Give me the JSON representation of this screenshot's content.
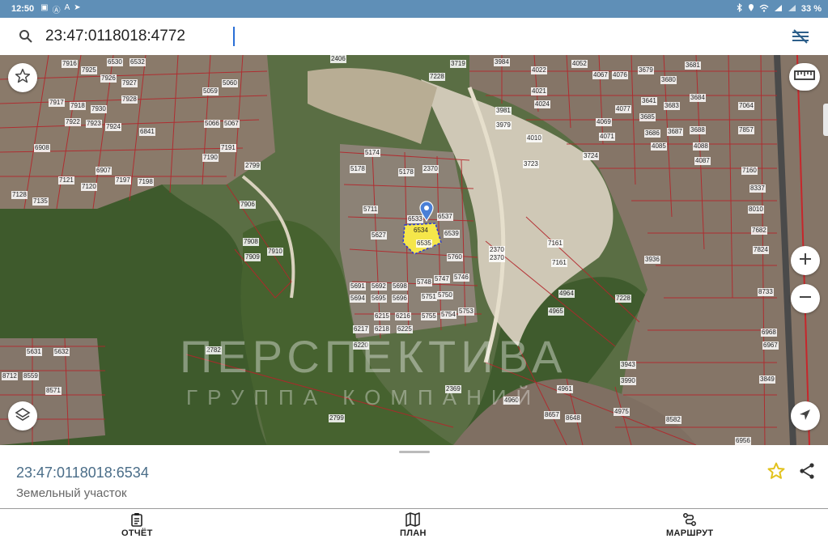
{
  "status_bar": {
    "time": "12:50",
    "left_glyphs": [
      "▣",
      "Ⓐ",
      "A",
      "➤"
    ],
    "battery": "33 %"
  },
  "search": {
    "query": "23:47:0118018:4772",
    "icon": "search-icon",
    "filter_icon": "filter-icon"
  },
  "map": {
    "watermark": "ПЕРСПЕКТИВА",
    "watermark_sub": "ГРУППА КОМПАНИЙ",
    "selected_parcel": "6534",
    "parcels": [
      {
        "id": "7916"
      },
      {
        "id": "7925"
      },
      {
        "id": "7926"
      },
      {
        "id": "7927"
      },
      {
        "id": "7917"
      },
      {
        "id": "7918"
      },
      {
        "id": "7930"
      },
      {
        "id": "7928"
      },
      {
        "id": "7922"
      },
      {
        "id": "7923"
      },
      {
        "id": "7924"
      },
      {
        "id": "6841"
      },
      {
        "id": "6908"
      },
      {
        "id": "6907"
      },
      {
        "id": "7121"
      },
      {
        "id": "7120"
      },
      {
        "id": "7128"
      },
      {
        "id": "7135"
      },
      {
        "id": "7198"
      },
      {
        "id": "7197"
      },
      {
        "id": "6530"
      },
      {
        "id": "6532"
      },
      {
        "id": "5066"
      },
      {
        "id": "5067"
      },
      {
        "id": "5059"
      },
      {
        "id": "5060"
      },
      {
        "id": "7191"
      },
      {
        "id": "7190"
      },
      {
        "id": "2799"
      },
      {
        "id": "7908"
      },
      {
        "id": "7909"
      },
      {
        "id": "7910"
      },
      {
        "id": "7906"
      },
      {
        "id": "2406"
      },
      {
        "id": "5174"
      },
      {
        "id": "5178"
      },
      {
        "id": "5178"
      },
      {
        "id": "2370"
      },
      {
        "id": "6537"
      },
      {
        "id": "6539"
      },
      {
        "id": "6533"
      },
      {
        "id": "6535"
      },
      {
        "id": "5711"
      },
      {
        "id": "5627"
      },
      {
        "id": "5760"
      },
      {
        "id": "5748"
      },
      {
        "id": "5747"
      },
      {
        "id": "5746"
      },
      {
        "id": "5691"
      },
      {
        "id": "5692"
      },
      {
        "id": "5698"
      },
      {
        "id": "5694"
      },
      {
        "id": "5695"
      },
      {
        "id": "5696"
      },
      {
        "id": "5751"
      },
      {
        "id": "5750"
      },
      {
        "id": "6215"
      },
      {
        "id": "6216"
      },
      {
        "id": "5755"
      },
      {
        "id": "5754"
      },
      {
        "id": "5753"
      },
      {
        "id": "6217"
      },
      {
        "id": "6218"
      },
      {
        "id": "6225"
      },
      {
        "id": "6220"
      },
      {
        "id": "2370"
      },
      {
        "id": "2782"
      },
      {
        "id": "5631"
      },
      {
        "id": "5632"
      },
      {
        "id": "8712"
      },
      {
        "id": "8559"
      },
      {
        "id": "8571"
      },
      {
        "id": "2369"
      },
      {
        "id": "2799"
      },
      {
        "id": "7228"
      },
      {
        "id": "3719"
      },
      {
        "id": "3984"
      },
      {
        "id": "4022"
      },
      {
        "id": "4021"
      },
      {
        "id": "3981"
      },
      {
        "id": "3979"
      },
      {
        "id": "4010"
      },
      {
        "id": "4024"
      },
      {
        "id": "4052"
      },
      {
        "id": "4067"
      },
      {
        "id": "4076"
      },
      {
        "id": "4069"
      },
      {
        "id": "4071"
      },
      {
        "id": "4077"
      },
      {
        "id": "3679"
      },
      {
        "id": "3680"
      },
      {
        "id": "3681"
      },
      {
        "id": "3641"
      },
      {
        "id": "3683"
      },
      {
        "id": "3684"
      },
      {
        "id": "3685"
      },
      {
        "id": "3686"
      },
      {
        "id": "3687"
      },
      {
        "id": "3688"
      },
      {
        "id": "4088"
      },
      {
        "id": "4087"
      },
      {
        "id": "4085"
      },
      {
        "id": "7064"
      },
      {
        "id": "7857"
      },
      {
        "id": "7160"
      },
      {
        "id": "8337"
      },
      {
        "id": "8010"
      },
      {
        "id": "7682"
      },
      {
        "id": "7824"
      },
      {
        "id": "8733"
      },
      {
        "id": "7228"
      },
      {
        "id": "7161"
      },
      {
        "id": "7161"
      },
      {
        "id": "4964"
      },
      {
        "id": "4965"
      },
      {
        "id": "3936"
      },
      {
        "id": "3943"
      },
      {
        "id": "3990"
      },
      {
        "id": "6968"
      },
      {
        "id": "6967"
      },
      {
        "id": "3849"
      },
      {
        "id": "4961"
      },
      {
        "id": "4960"
      },
      {
        "id": "8657"
      },
      {
        "id": "8648"
      },
      {
        "id": "4975"
      },
      {
        "id": "8582"
      },
      {
        "id": "6956"
      },
      {
        "id": "2370"
      },
      {
        "id": "3723"
      },
      {
        "id": "3724"
      }
    ]
  },
  "sheet": {
    "number": "23:47:0118018:6534",
    "type": "Земельный участок"
  },
  "nav": {
    "report": "ОТЧЁТ",
    "plan": "ПЛАН",
    "route": "МАРШРУТ"
  },
  "colors": {
    "status_bar": "#5f8fb7",
    "parcel_border": "#b3262b",
    "selected_fill": "#f5e64a",
    "selected_border": "#2a3ad6",
    "accent_star": "#e2c21c",
    "number_text": "#4a6d88"
  }
}
